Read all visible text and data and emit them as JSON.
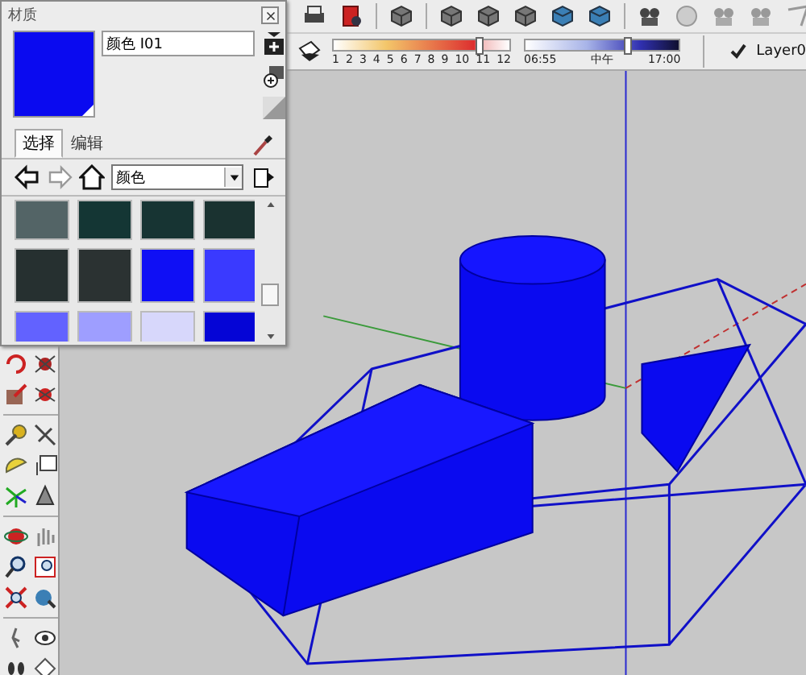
{
  "materials_panel": {
    "title": "材质",
    "material_name": "颜色 I01",
    "tabs": [
      {
        "label": "选择",
        "selected": true
      },
      {
        "label": "编辑",
        "selected": false
      }
    ],
    "library": "颜色",
    "swatches": [
      {
        "color": "#536466"
      },
      {
        "color": "#143634"
      },
      {
        "color": "#173433"
      },
      {
        "color": "#1a3230"
      },
      {
        "color": "#263030"
      },
      {
        "color": "#2b3232"
      },
      {
        "color": "#0f0ff5"
      },
      {
        "color": "#3a3aff"
      },
      {
        "color": "#6262ff"
      },
      {
        "color": "#9e9eff"
      },
      {
        "color": "#d7d7fb"
      },
      {
        "color": "#0505d6"
      }
    ]
  },
  "shadow_toolbar": {
    "months": [
      "1",
      "2",
      "3",
      "4",
      "5",
      "6",
      "7",
      "8",
      "9",
      "10",
      "11",
      "12"
    ],
    "month_slider": {
      "level": 0.83
    },
    "time_start": "06:55",
    "time_mid": "中午",
    "time_end": "17:00",
    "time_slider": {
      "level": 0.66
    }
  },
  "layer_toolbar": {
    "current": true,
    "name": "Layer0"
  }
}
